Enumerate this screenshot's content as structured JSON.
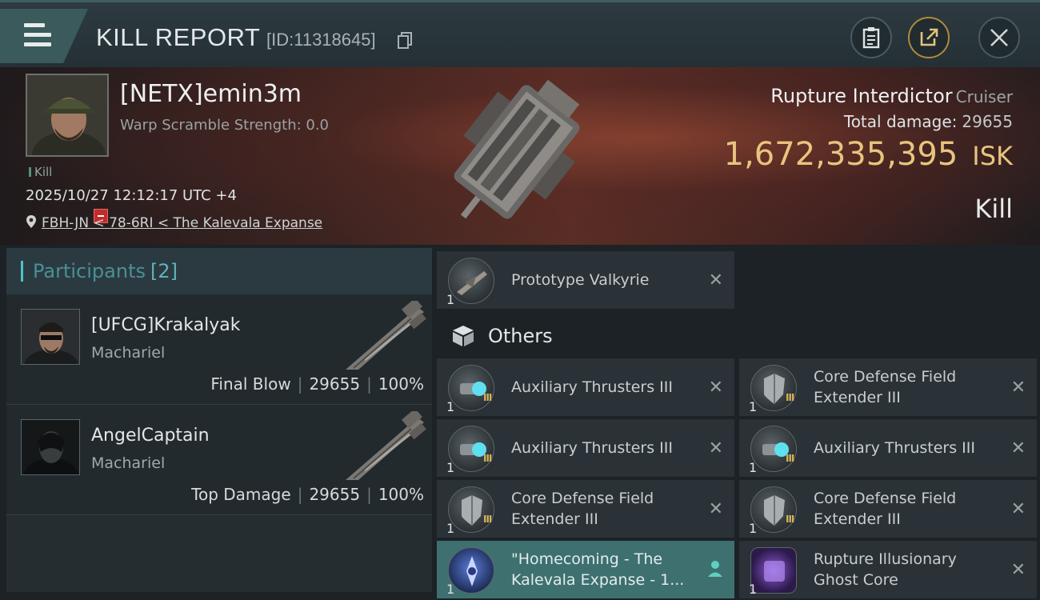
{
  "header": {
    "title": "KILL REPORT",
    "report_id": "[ID:11318645]"
  },
  "victim": {
    "name": "[NETX]emin3m",
    "scramble": "Warp Scramble Strength: 0.0",
    "tag": "Kill",
    "datetime": "2025/10/27 12:12:17 UTC +4",
    "location": "FBH-JN < 78-6RI < The Kalevala Expanse",
    "ship_name": "Rupture Interdictor",
    "ship_class": "Cruiser",
    "total_damage_label": "Total damage:",
    "total_damage": "29655",
    "isk_value": "1,672,335,395",
    "isk_unit": "ISK",
    "outcome": "Kill"
  },
  "participants": {
    "label": "Participants",
    "count": "[2]",
    "rows": [
      {
        "name": "[UFCG]Krakalyak",
        "ship": "Machariel",
        "role": "Final Blow",
        "damage": "29655",
        "percent": "100%"
      },
      {
        "name": "AngelCaptain",
        "ship": "Machariel",
        "role": "Top Damage",
        "damage": "29655",
        "percent": "100%"
      }
    ]
  },
  "items": {
    "drone": {
      "name": "Prototype  Valkyrie",
      "qty": "1"
    },
    "others_label": "Others",
    "list": [
      {
        "name": "Auxiliary Thrusters III",
        "qty": "1",
        "level": "III"
      },
      {
        "name": "Core Defense Field Extender III",
        "qty": "1",
        "level": "III"
      },
      {
        "name": "Auxiliary Thrusters III",
        "qty": "1",
        "level": "III"
      },
      {
        "name": "Auxiliary Thrusters III",
        "qty": "1",
        "level": "III"
      },
      {
        "name": "Core Defense Field Extender III",
        "qty": "1",
        "level": "III"
      },
      {
        "name": "Core Defense Field Extender III",
        "qty": "1",
        "level": "III"
      },
      {
        "name": "\"Homecoming - The Kalevala Expanse - 1...",
        "qty": "1",
        "level": ""
      },
      {
        "name": "Rupture Illusionary Ghost Core",
        "qty": "1",
        "level": ""
      }
    ]
  },
  "colors": {
    "accent_teal": "#4ec2c2",
    "isk_gold": "#e8c57e",
    "highlight_row": "#3e7070"
  }
}
